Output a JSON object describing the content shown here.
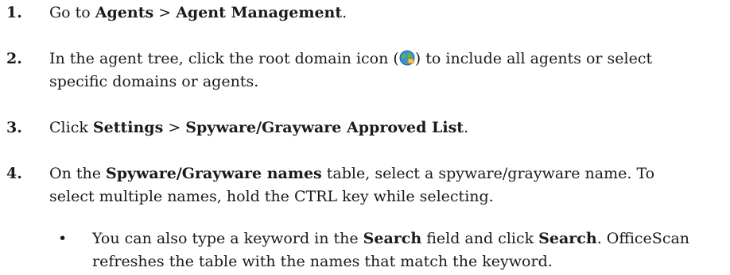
{
  "steps": [
    {
      "num": "1.",
      "pre": "Go to ",
      "b1": "Agents",
      "sep": " > ",
      "b2": "Agent Management",
      "post": "."
    },
    {
      "num": "2.",
      "pre": "In the agent tree, click the root domain icon (",
      "post": ") to include all agents or select",
      "line2": "specific domains or agents."
    },
    {
      "num": "3.",
      "pre": "Click ",
      "b1": "Settings",
      "sep": " > ",
      "b2": "Spyware/Grayware Approved List",
      "post": "."
    },
    {
      "num": "4.",
      "pre": "On the ",
      "b1": "Spyware/Grayware names",
      "post": " table, select a spyware/grayware name. To",
      "line2": "select multiple names, hold the CTRL key while selecting."
    }
  ],
  "bullet": {
    "marker": "•",
    "pre": "You can also type a keyword in the ",
    "b1": "Search",
    "mid": " field and click ",
    "b2": "Search",
    "post": ". OfficeScan",
    "line2": "refreshes the table with the names that match the keyword."
  },
  "icons": {
    "root_domain": "globe-domain-icon"
  }
}
